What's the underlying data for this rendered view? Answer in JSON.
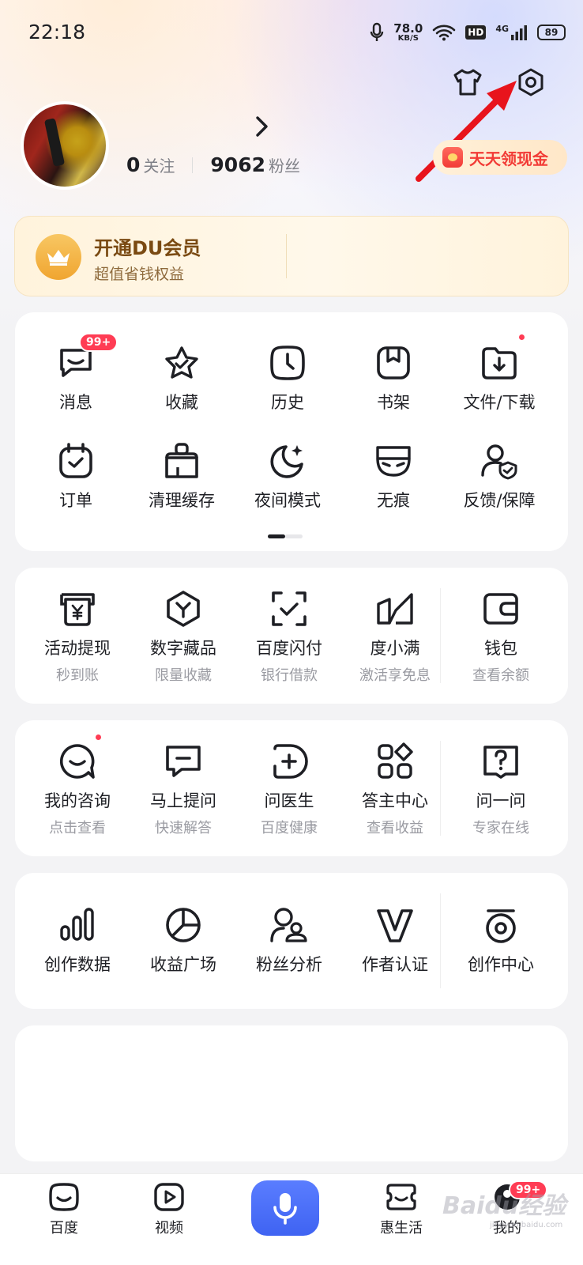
{
  "status_bar": {
    "time": "22:18",
    "speed_value": "78.0",
    "speed_unit": "KB/S",
    "hd_label": "HD",
    "network_label": "4G",
    "battery": "89"
  },
  "profile": {
    "follow_count": "0",
    "follow_label": "关注",
    "fans_count": "9062",
    "fans_label": "粉丝",
    "gold_button_label": "天天领现金"
  },
  "vip": {
    "title": "开通DU会员",
    "subtitle": "超值省钱权益"
  },
  "quick_grid": {
    "row1": [
      {
        "label": "消息",
        "icon": "message-icon",
        "badge": "99+"
      },
      {
        "label": "收藏",
        "icon": "star-icon"
      },
      {
        "label": "历史",
        "icon": "clock-icon"
      },
      {
        "label": "书架",
        "icon": "bookshelf-icon"
      },
      {
        "label": "文件/下载",
        "icon": "download-folder-icon",
        "dot": true
      }
    ],
    "row2": [
      {
        "label": "订单",
        "icon": "calendar-check-icon"
      },
      {
        "label": "清理缓存",
        "icon": "broom-icon"
      },
      {
        "label": "夜间模式",
        "icon": "moon-icon"
      },
      {
        "label": "无痕",
        "icon": "mask-icon"
      },
      {
        "label": "反馈/保障",
        "icon": "user-shield-icon"
      }
    ]
  },
  "finance": [
    {
      "label": "活动提现",
      "sub": "秒到账",
      "icon": "yuan-atm-icon"
    },
    {
      "label": "数字藏品",
      "sub": "限量收藏",
      "icon": "hexagon-y-icon"
    },
    {
      "label": "百度闪付",
      "sub": "银行借款",
      "icon": "scan-check-icon"
    },
    {
      "label": "度小满",
      "sub": "激活享免息",
      "icon": "duxiaoman-icon"
    },
    {
      "label": "钱包",
      "sub": "查看余额",
      "icon": "wallet-icon"
    }
  ],
  "consult": [
    {
      "label": "我的咨询",
      "sub": "点击查看",
      "icon": "chat-smile-icon",
      "dot": true
    },
    {
      "label": "马上提问",
      "sub": "快速解答",
      "icon": "chat-minus-icon"
    },
    {
      "label": "问医生",
      "sub": "百度健康",
      "icon": "doctor-plus-icon"
    },
    {
      "label": "答主中心",
      "sub": "查看收益",
      "icon": "apps-grid-icon"
    },
    {
      "label": "问一问",
      "sub": "专家在线",
      "icon": "question-bubble-icon"
    }
  ],
  "creator": [
    {
      "label": "创作数据",
      "icon": "bar-chart-icon"
    },
    {
      "label": "收益广场",
      "icon": "pie-chart-icon"
    },
    {
      "label": "粉丝分析",
      "icon": "fans-icon"
    },
    {
      "label": "作者认证",
      "icon": "v-badge-icon"
    },
    {
      "label": "创作中心",
      "icon": "creator-center-icon"
    }
  ],
  "bottom_nav": [
    {
      "label": "百度",
      "icon": "baidu-home-icon"
    },
    {
      "label": "视频",
      "icon": "video-play-icon"
    },
    {
      "label": "",
      "icon": "microphone-icon"
    },
    {
      "label": "惠生活",
      "icon": "life-icon"
    },
    {
      "label": "我的",
      "icon": "profile-icon",
      "badge": "99+"
    }
  ],
  "watermark": "Baidu经验",
  "watermark_sub": "jingyan.baidu.com",
  "colors": {
    "badge_red": "#ff3c54",
    "mic_blue": "#4a6cf7",
    "vip_gold": "#f0a530",
    "arrow_red": "#e8141c"
  }
}
